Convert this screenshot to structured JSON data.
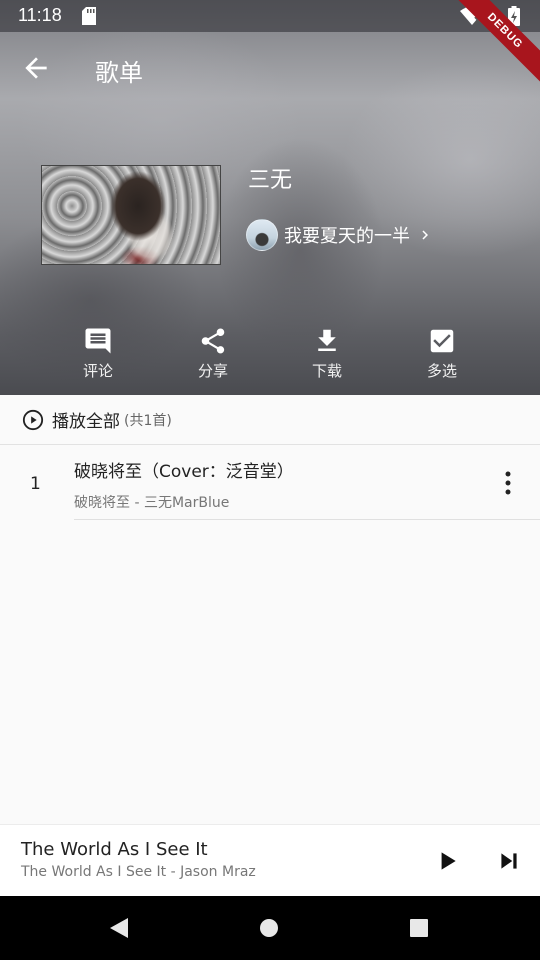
{
  "status_bar": {
    "time": "11:18",
    "icons": [
      "sd-card-icon",
      "wifi-icon",
      "battery-icon"
    ]
  },
  "debug_banner": "DEBUG",
  "app_bar": {
    "title": "歌单",
    "back_icon": "arrow-back-icon"
  },
  "playlist": {
    "name": "三无",
    "creator": "我要夏天的一半"
  },
  "actions": [
    {
      "label": "评论",
      "icon": "comment-icon"
    },
    {
      "label": "分享",
      "icon": "share-icon"
    },
    {
      "label": "下载",
      "icon": "download-icon"
    },
    {
      "label": "多选",
      "icon": "checkbox-icon"
    }
  ],
  "play_all": {
    "label": "播放全部",
    "count": "(共1首)"
  },
  "songs": [
    {
      "index": "1",
      "title": "破晓将至（Cover：泛音堂）",
      "subtitle": "破晓将至 - 三无MarBlue"
    }
  ],
  "mini_player": {
    "title": "The World As I See It",
    "subtitle": "The World As I See It - Jason Mraz"
  },
  "colors": {
    "primary_text": "#222222",
    "secondary_text": "#777777",
    "debug_ribbon": "#a8151d"
  }
}
